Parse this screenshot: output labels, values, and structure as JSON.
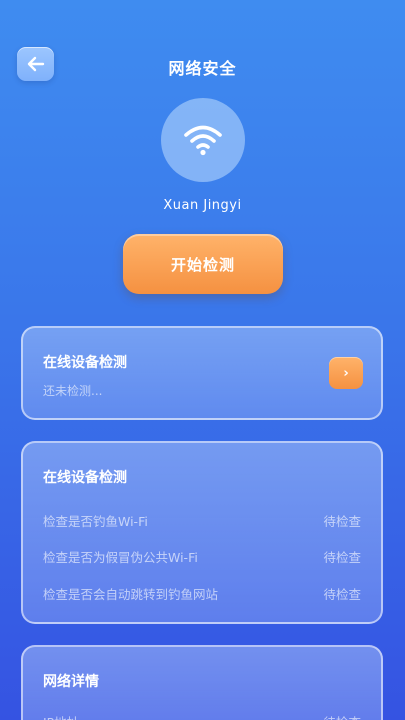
{
  "header": {
    "title": "网络安全",
    "back_icon": "arrow-left-icon"
  },
  "network": {
    "icon": "wifi-icon",
    "name": "Xuan Jingyi"
  },
  "start_button": {
    "label": "开始检测"
  },
  "online_check_card": {
    "title": "在线设备检测",
    "status": "还未检测...",
    "arrow_icon": "chevron-right-icon"
  },
  "check_list_card": {
    "title": "在线设备检测",
    "items": [
      {
        "label": "检查是否钓鱼Wi-Fi",
        "status": "待检查"
      },
      {
        "label": "检查是否为假冒伪公共Wi-Fi",
        "status": "待检查"
      },
      {
        "label": "检查是否会自动跳转到钓鱼网站",
        "status": "待检查"
      }
    ]
  },
  "network_details_card": {
    "title": "网络详情",
    "items": [
      {
        "label": "IP地址",
        "status": "待检查"
      }
    ]
  },
  "colors": {
    "accent_orange": "#f59141",
    "bg_blue": "#3a76ea"
  }
}
